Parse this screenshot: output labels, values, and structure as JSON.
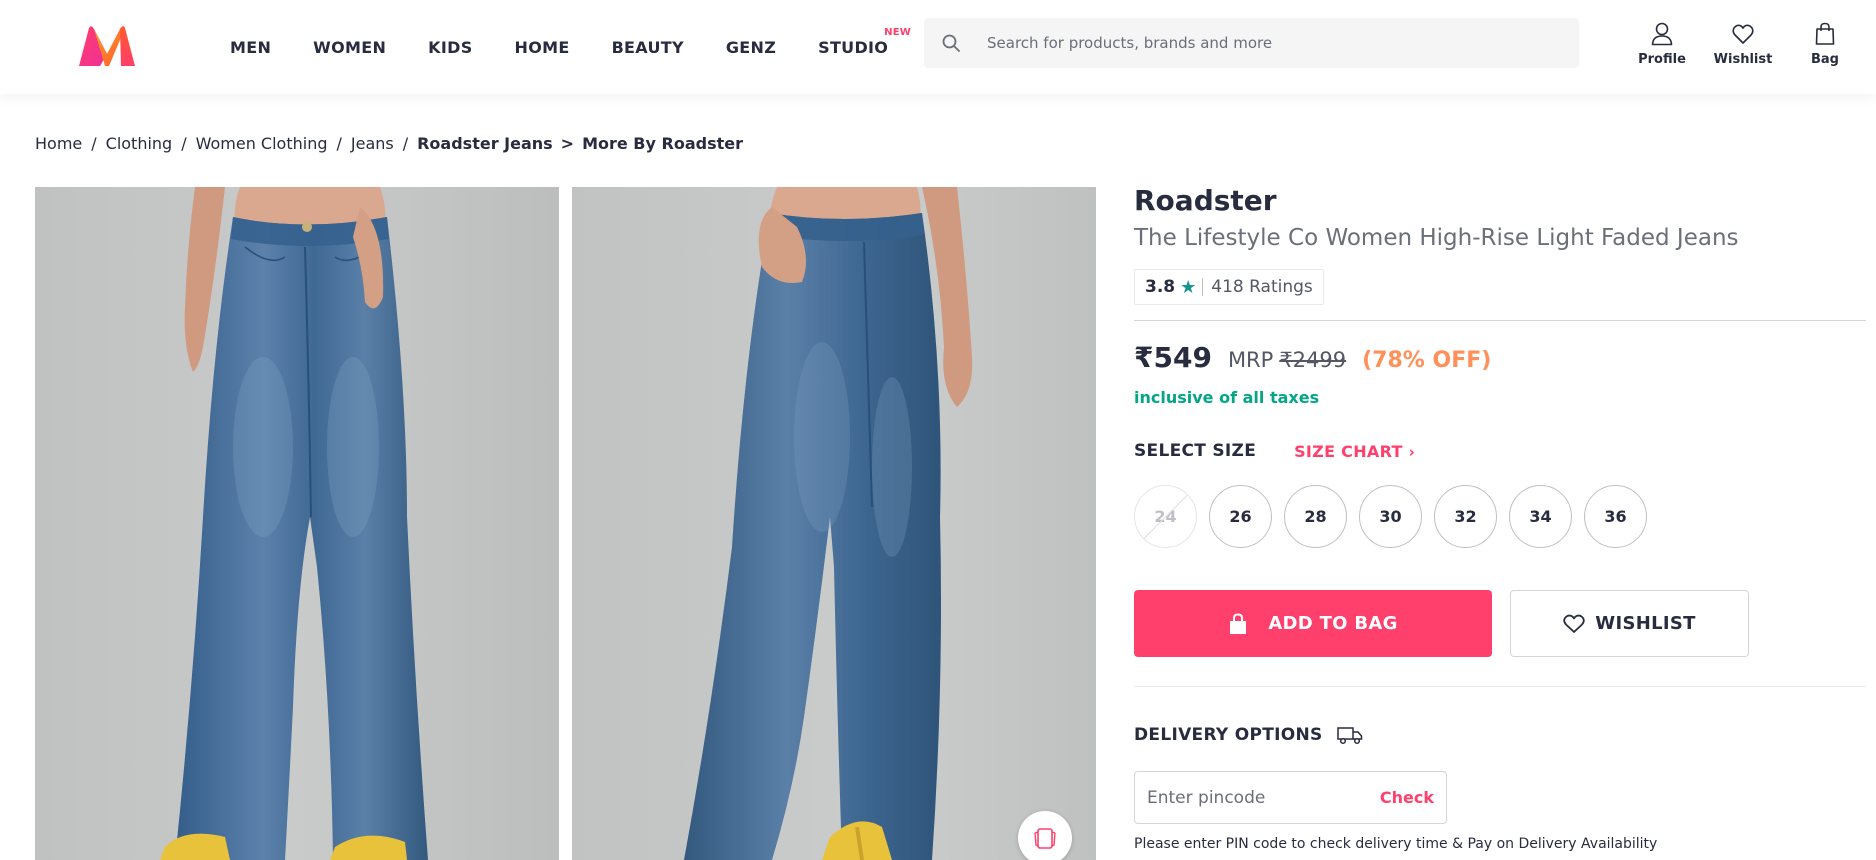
{
  "header": {
    "logo_alt": "Myntra",
    "nav": [
      {
        "label": "MEN"
      },
      {
        "label": "WOMEN"
      },
      {
        "label": "KIDS"
      },
      {
        "label": "HOME"
      },
      {
        "label": "BEAUTY"
      },
      {
        "label": "GENZ"
      },
      {
        "label": "STUDIO",
        "badge": "NEW"
      }
    ],
    "search_placeholder": "Search for products, brands and more",
    "actions": [
      {
        "label": "Profile",
        "icon": "user-icon"
      },
      {
        "label": "Wishlist",
        "icon": "heart-icon"
      },
      {
        "label": "Bag",
        "icon": "bag-icon"
      }
    ]
  },
  "breadcrumb": {
    "items": [
      "Home",
      "Clothing",
      "Women Clothing",
      "Jeans"
    ],
    "current": "Roadster Jeans",
    "more": "More By Roadster"
  },
  "product": {
    "brand": "Roadster",
    "name": "The Lifestyle Co Women High-Rise Light Faded Jeans",
    "rating": "3.8",
    "rating_count": "418 Ratings",
    "price": "₹549",
    "mrp_label": "MRP",
    "mrp": "₹2499",
    "discount": "(78% OFF)",
    "tax_note": "inclusive of all taxes"
  },
  "sizes": {
    "title": "SELECT SIZE",
    "chart_label": "SIZE CHART",
    "options": [
      {
        "label": "24",
        "available": false
      },
      {
        "label": "26",
        "available": true
      },
      {
        "label": "28",
        "available": true
      },
      {
        "label": "30",
        "available": true
      },
      {
        "label": "32",
        "available": true
      },
      {
        "label": "34",
        "available": true
      },
      {
        "label": "36",
        "available": true
      }
    ]
  },
  "buttons": {
    "add_to_bag": "ADD TO BAG",
    "wishlist": "WISHLIST"
  },
  "delivery": {
    "title": "DELIVERY OPTIONS",
    "pincode_placeholder": "Enter pincode",
    "check_label": "Check",
    "note": "Please enter PIN code to check delivery time & Pay on Delivery Availability"
  },
  "colors": {
    "accent": "#ff3f6c",
    "discount": "#ff905a",
    "tax": "#03a685",
    "rating_star": "#14958f",
    "text": "#282c3f"
  }
}
